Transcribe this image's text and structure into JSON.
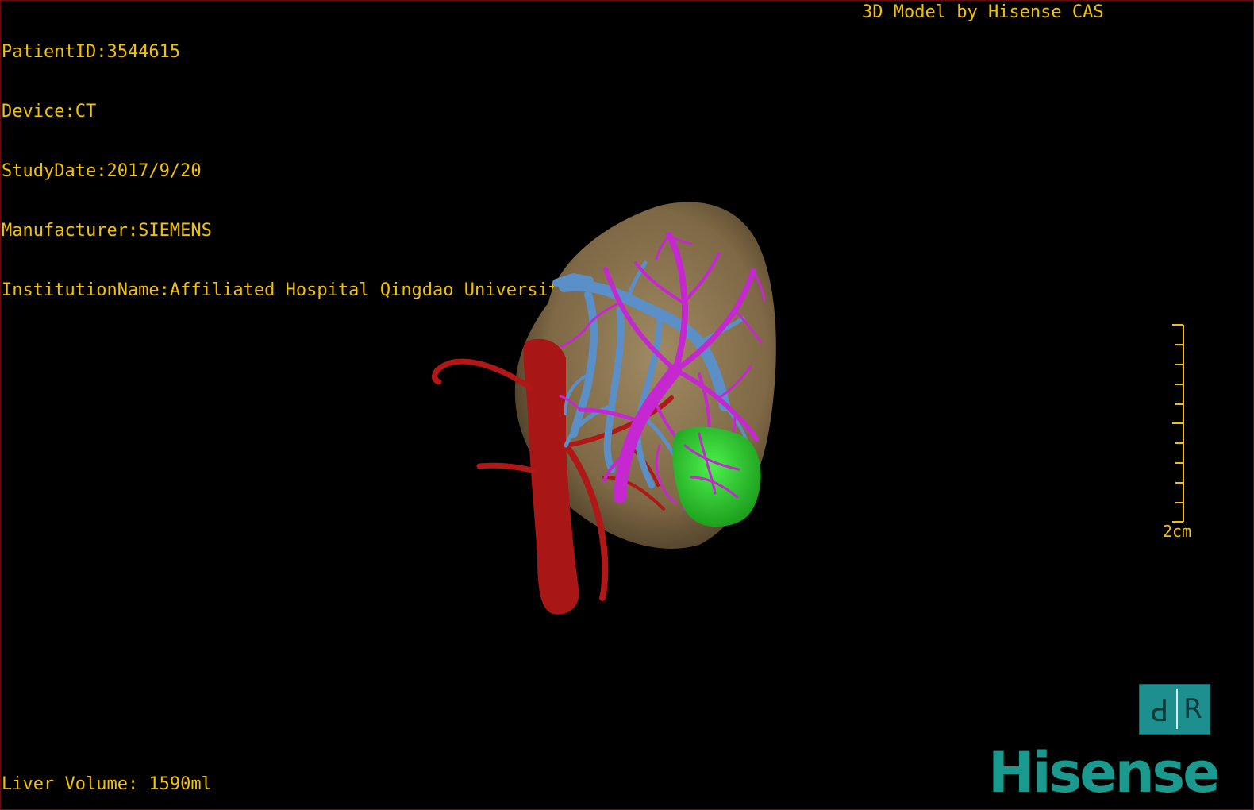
{
  "overlay": {
    "patient_id": "PatientID:3544615",
    "device": "Device:CT",
    "study_date": "StudyDate:2017/9/20",
    "manufacturer": "Manufacturer:SIEMENS",
    "institution": "InstitutionName:Affiliated Hospital Qingdao University-C",
    "credit": "3D Model by Hisense CAS",
    "liver_volume": "Liver Volume: 1590ml"
  },
  "scale": {
    "label": "2cm"
  },
  "orientation_cube": {
    "face_left": "P",
    "face_right": "R"
  },
  "brand": {
    "name": "Hisense"
  },
  "colors": {
    "overlay_text": "#f2c200",
    "liver": "#8c7450",
    "artery": "#b01818",
    "portal_vein": "#c528d0",
    "hepatic_vein": "#5a8fc8",
    "tumor": "#2fd02f",
    "brand": "#1a9a8e",
    "cube": "#1d8f8f"
  }
}
